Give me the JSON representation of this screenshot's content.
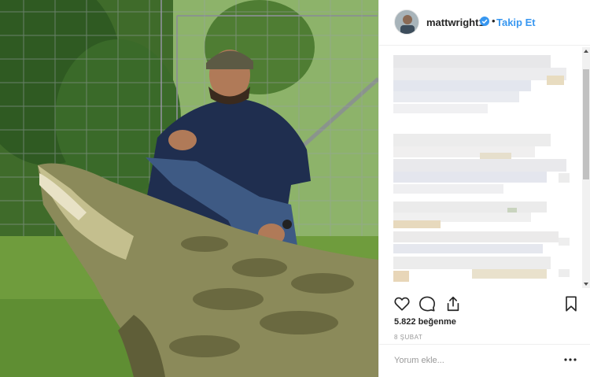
{
  "post": {
    "username": "mattwright1",
    "separator": "•",
    "follow_label": "Takip Et",
    "likes": "5.822 beğenme",
    "date": "8 ŞUBAT",
    "comment_placeholder": "Yorum ekle..."
  },
  "icons": {
    "verified": "verified-badge-icon",
    "like": "heart-icon",
    "comment": "comment-icon",
    "share": "share-icon",
    "save": "bookmark-icon",
    "more": "more-options-icon"
  },
  "colors": {
    "link": "#3897f0",
    "verified": "#3897f0",
    "text": "#262626",
    "muted": "#999999"
  }
}
